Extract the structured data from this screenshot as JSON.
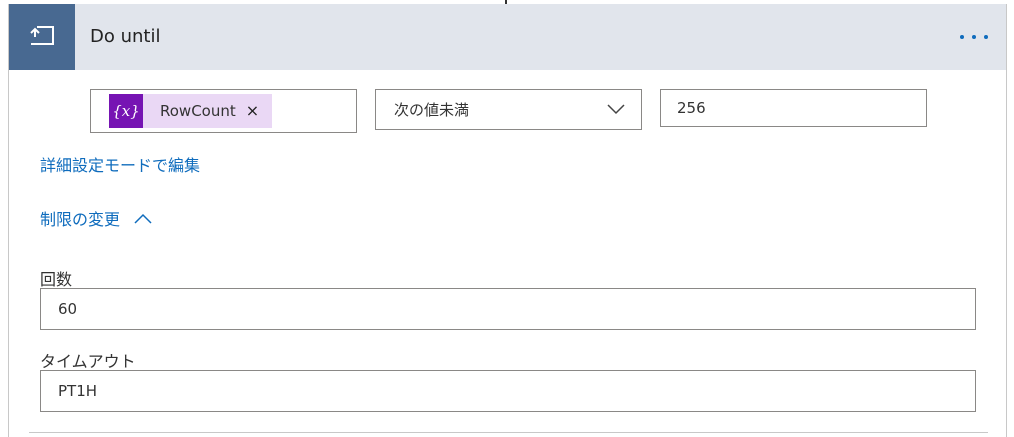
{
  "header": {
    "title": "Do until",
    "icon": "loop-return-icon",
    "more_icon": "more-options-icon"
  },
  "condition": {
    "token_icon_text": "{x}",
    "token_label": "RowCount",
    "token_remove": "×",
    "operator": "次の値未満",
    "value": "256"
  },
  "links": {
    "advanced_mode": "詳細設定モードで編集",
    "change_limits": "制限の変更"
  },
  "limits": {
    "count_label": "回数",
    "count_value": "60",
    "timeout_label": "タイムアウト",
    "timeout_value": "PT1H"
  },
  "colors": {
    "header_bg": "#e1e5ec",
    "icon_bg": "#486991",
    "token_bg": "#ead8f5",
    "token_icon_bg": "#7614b3",
    "link": "#0f6cbd"
  }
}
